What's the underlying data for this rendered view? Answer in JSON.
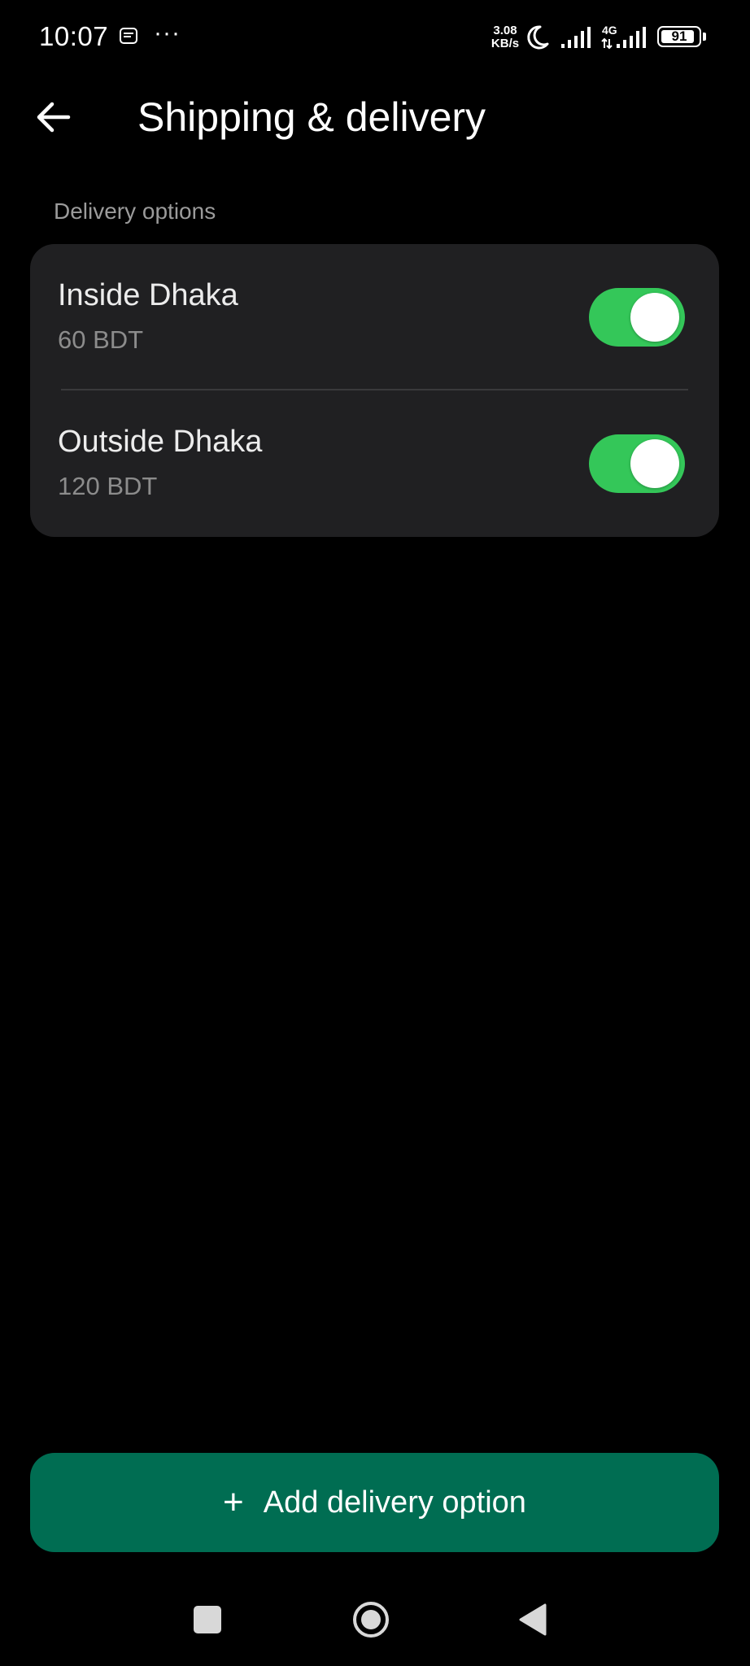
{
  "status_bar": {
    "time": "10:07",
    "overflow_dots": "···",
    "speed_value": "3.08",
    "speed_unit": "KB/s",
    "network_type": "4G",
    "battery_level": "91",
    "battery_fraction": 0.91
  },
  "app_bar": {
    "back_icon": "arrow-left-icon",
    "title": "Shipping & delivery"
  },
  "delivery_options": {
    "section_label": "Delivery options",
    "items": [
      {
        "name": "Inside Dhaka",
        "price": "60 BDT",
        "enabled": true
      },
      {
        "name": "Outside Dhaka",
        "price": "120 BDT",
        "enabled": true
      }
    ]
  },
  "add_button": {
    "icon": "plus-icon",
    "plus": "+",
    "label": "Add delivery option"
  },
  "nav_bar": {
    "recents_icon": "square-icon",
    "home_icon": "circle-home-icon",
    "back_icon": "triangle-back-icon"
  },
  "colors": {
    "background": "#000000",
    "card": "#202022",
    "toggle_on": "#34c759",
    "button": "#006d52",
    "secondary_text": "#8c8c8c"
  }
}
